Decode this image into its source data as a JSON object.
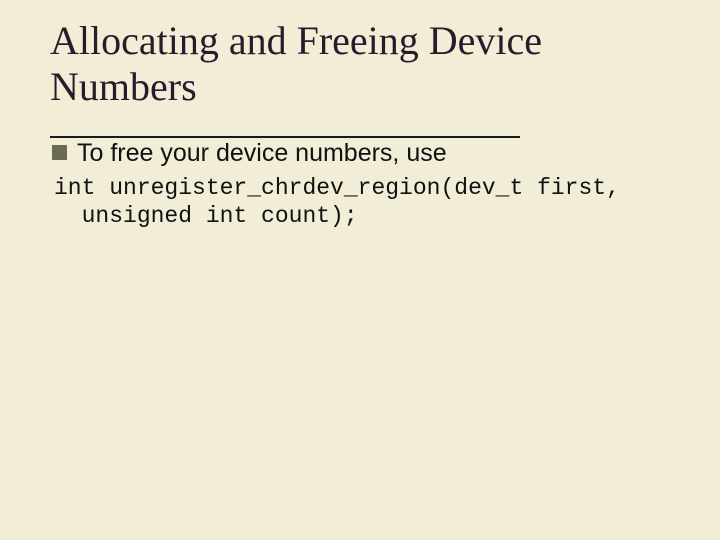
{
  "title": "Allocating and Freeing Device Numbers",
  "bullets": [
    {
      "text": "To free your device numbers, use"
    }
  ],
  "code": "int unregister_chrdev_region(dev_t first,\n  unsigned int count);"
}
